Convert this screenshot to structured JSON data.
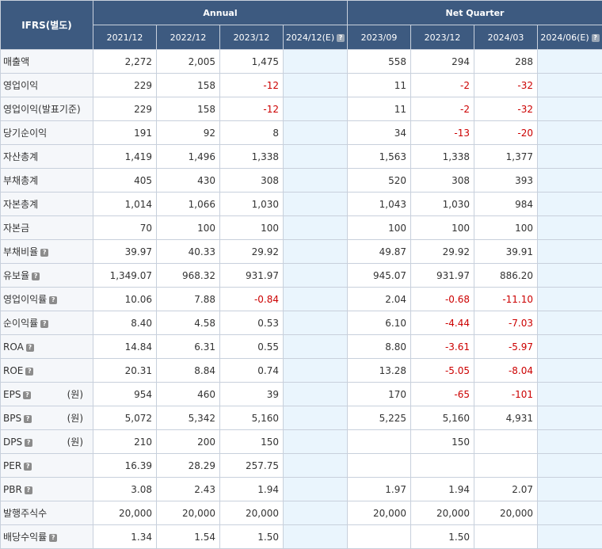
{
  "header": {
    "corner_label": "IFRS(별도)",
    "annual_label": "Annual",
    "quarter_label": "Net Quarter",
    "periods": [
      "2021/12",
      "2022/12",
      "2023/12",
      "2024/12(E)",
      "2023/09",
      "2023/12",
      "2024/03",
      "2024/06(E)"
    ],
    "period_help": [
      false,
      false,
      false,
      true,
      false,
      false,
      false,
      true
    ]
  },
  "help_glyph": "?",
  "rows": [
    {
      "label": "매출액",
      "help": false,
      "unit": "",
      "values": [
        "2,272",
        "2,005",
        "1,475",
        "",
        "558",
        "294",
        "288",
        ""
      ]
    },
    {
      "label": "영업이익",
      "help": false,
      "unit": "",
      "values": [
        "229",
        "158",
        "-12",
        "",
        "11",
        "-2",
        "-32",
        ""
      ]
    },
    {
      "label": "영업이익(발표기준)",
      "help": false,
      "unit": "",
      "values": [
        "229",
        "158",
        "-12",
        "",
        "11",
        "-2",
        "-32",
        ""
      ]
    },
    {
      "label": "당기순이익",
      "help": false,
      "unit": "",
      "values": [
        "191",
        "92",
        "8",
        "",
        "34",
        "-13",
        "-20",
        ""
      ]
    },
    {
      "label": "자산총계",
      "help": false,
      "unit": "",
      "values": [
        "1,419",
        "1,496",
        "1,338",
        "",
        "1,563",
        "1,338",
        "1,377",
        ""
      ]
    },
    {
      "label": "부채총계",
      "help": false,
      "unit": "",
      "values": [
        "405",
        "430",
        "308",
        "",
        "520",
        "308",
        "393",
        ""
      ]
    },
    {
      "label": "자본총계",
      "help": false,
      "unit": "",
      "values": [
        "1,014",
        "1,066",
        "1,030",
        "",
        "1,043",
        "1,030",
        "984",
        ""
      ]
    },
    {
      "label": "자본금",
      "help": false,
      "unit": "",
      "values": [
        "70",
        "100",
        "100",
        "",
        "100",
        "100",
        "100",
        ""
      ]
    },
    {
      "label": "부채비율",
      "help": true,
      "unit": "",
      "values": [
        "39.97",
        "40.33",
        "29.92",
        "",
        "49.87",
        "29.92",
        "39.91",
        ""
      ]
    },
    {
      "label": "유보율",
      "help": true,
      "unit": "",
      "values": [
        "1,349.07",
        "968.32",
        "931.97",
        "",
        "945.07",
        "931.97",
        "886.20",
        ""
      ]
    },
    {
      "label": "영업이익률",
      "help": true,
      "unit": "",
      "values": [
        "10.06",
        "7.88",
        "-0.84",
        "",
        "2.04",
        "-0.68",
        "-11.10",
        ""
      ]
    },
    {
      "label": "순이익률",
      "help": true,
      "unit": "",
      "values": [
        "8.40",
        "4.58",
        "0.53",
        "",
        "6.10",
        "-4.44",
        "-7.03",
        ""
      ]
    },
    {
      "label": "ROA",
      "help": true,
      "unit": "",
      "values": [
        "14.84",
        "6.31",
        "0.55",
        "",
        "8.80",
        "-3.61",
        "-5.97",
        ""
      ]
    },
    {
      "label": "ROE",
      "help": true,
      "unit": "",
      "values": [
        "20.31",
        "8.84",
        "0.74",
        "",
        "13.28",
        "-5.05",
        "-8.04",
        ""
      ]
    },
    {
      "label": "EPS",
      "help": true,
      "unit": "(원)",
      "values": [
        "954",
        "460",
        "39",
        "",
        "170",
        "-65",
        "-101",
        ""
      ]
    },
    {
      "label": "BPS",
      "help": true,
      "unit": "(원)",
      "values": [
        "5,072",
        "5,342",
        "5,160",
        "",
        "5,225",
        "5,160",
        "4,931",
        ""
      ]
    },
    {
      "label": "DPS",
      "help": true,
      "unit": "(원)",
      "values": [
        "210",
        "200",
        "150",
        "",
        "",
        "150",
        "",
        ""
      ]
    },
    {
      "label": "PER",
      "help": true,
      "unit": "",
      "values": [
        "16.39",
        "28.29",
        "257.75",
        "",
        "",
        "",
        "",
        ""
      ]
    },
    {
      "label": "PBR",
      "help": true,
      "unit": "",
      "values": [
        "3.08",
        "2.43",
        "1.94",
        "",
        "1.97",
        "1.94",
        "2.07",
        ""
      ]
    },
    {
      "label": "발행주식수",
      "help": false,
      "unit": "",
      "values": [
        "20,000",
        "20,000",
        "20,000",
        "",
        "20,000",
        "20,000",
        "20,000",
        ""
      ]
    },
    {
      "label": "배당수익률",
      "help": true,
      "unit": "",
      "values": [
        "1.34",
        "1.54",
        "1.50",
        "",
        "",
        "1.50",
        "",
        ""
      ]
    }
  ],
  "colors": {
    "header_bg": "#3d5a80",
    "negative": "#cc0000",
    "estimate_bg": "#eaf5fd",
    "label_bg": "#f5f7fa",
    "border": "#c8d0dc"
  }
}
